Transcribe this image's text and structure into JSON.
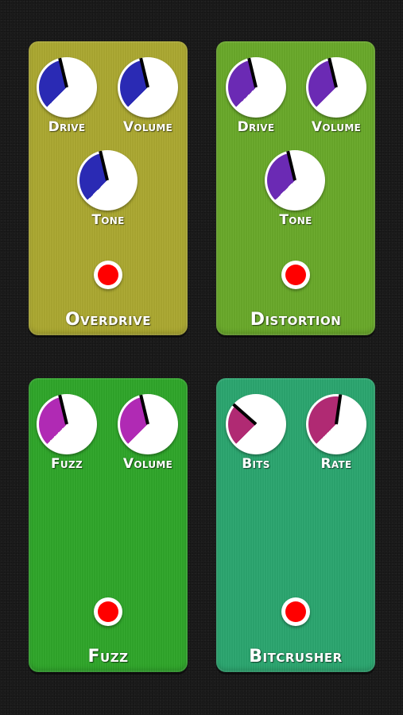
{
  "pedals": [
    {
      "name": "Overdrive",
      "color": "#aba831",
      "knob_color": "#2a2ab4",
      "knobs": [
        {
          "label": "Drive",
          "value": 0.45
        },
        {
          "label": "Volume",
          "value": 0.45
        },
        {
          "label": "Tone",
          "value": 0.45
        }
      ]
    },
    {
      "name": "Distortion",
      "color": "#69a92a",
      "knob_color": "#6b2ab4",
      "knobs": [
        {
          "label": "Drive",
          "value": 0.45
        },
        {
          "label": "Volume",
          "value": 0.45
        },
        {
          "label": "Tone",
          "value": 0.45
        }
      ]
    },
    {
      "name": "Fuzz",
      "color": "#2fa62a",
      "knob_color": "#b02ab4",
      "knobs": [
        {
          "label": "Fuzz",
          "value": 0.45
        },
        {
          "label": "Volume",
          "value": 0.45
        }
      ]
    },
    {
      "name": "Bitcrusher",
      "color": "#2ba66f",
      "knob_color": "#b02a73",
      "knobs": [
        {
          "label": "Bits",
          "value": 0.32
        },
        {
          "label": "Rate",
          "value": 0.53
        }
      ]
    }
  ],
  "led_color": "#ff0000"
}
